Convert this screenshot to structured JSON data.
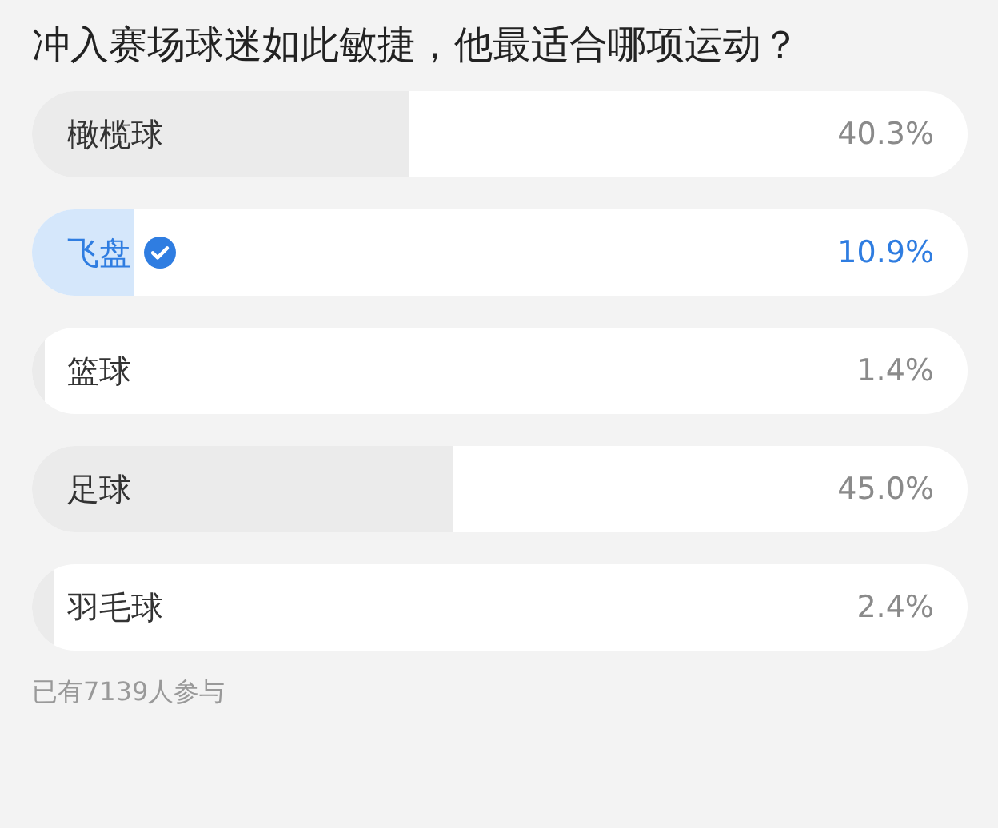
{
  "question": "冲入赛场球迷如此敏捷，他最适合哪项运动？",
  "options": [
    {
      "label": "橄榄球",
      "percent": "40.3%",
      "level": 0.403,
      "selected": false
    },
    {
      "label": "飞盘",
      "percent": "10.9%",
      "level": 0.109,
      "selected": true
    },
    {
      "label": "篮球",
      "percent": "1.4%",
      "level": 0.014,
      "selected": false
    },
    {
      "label": "足球",
      "percent": "45.0%",
      "level": 0.45,
      "selected": false
    },
    {
      "label": "羽毛球",
      "percent": "2.4%",
      "level": 0.024,
      "selected": false
    }
  ],
  "participants": "已有7139人参与"
}
